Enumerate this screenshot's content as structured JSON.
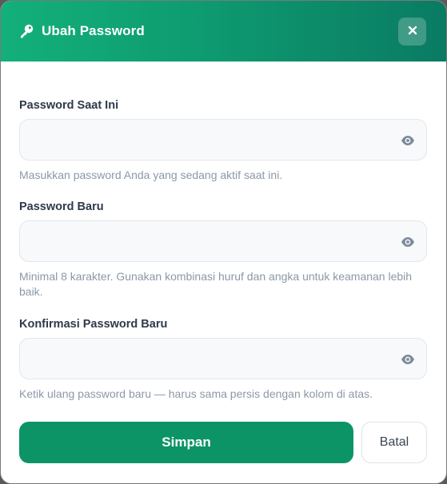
{
  "dialog": {
    "title": "Ubah Password",
    "icon": "key-icon",
    "close_icon": "close-icon"
  },
  "fields": [
    {
      "label": "Password Saat Ini",
      "value": "",
      "hint": "Masukkan password Anda yang sedang aktif saat ini.",
      "toggle_icon": "eye-icon"
    },
    {
      "label": "Password Baru",
      "value": "",
      "hint": "Minimal 8 karakter. Gunakan kombinasi huruf dan angka untuk keamanan lebih baik.",
      "toggle_icon": "eye-icon"
    },
    {
      "label": "Konfirmasi Password Baru",
      "value": "",
      "hint": "Ketik ulang password baru — harus sama persis dengan kolom di atas.",
      "toggle_icon": "eye-icon"
    }
  ],
  "actions": {
    "save_label": "Simpan",
    "cancel_label": "Batal"
  },
  "colors": {
    "header_start": "#13b07a",
    "header_end": "#0a7b63",
    "primary": "#0d9466",
    "hint_text": "#8c98a8"
  }
}
